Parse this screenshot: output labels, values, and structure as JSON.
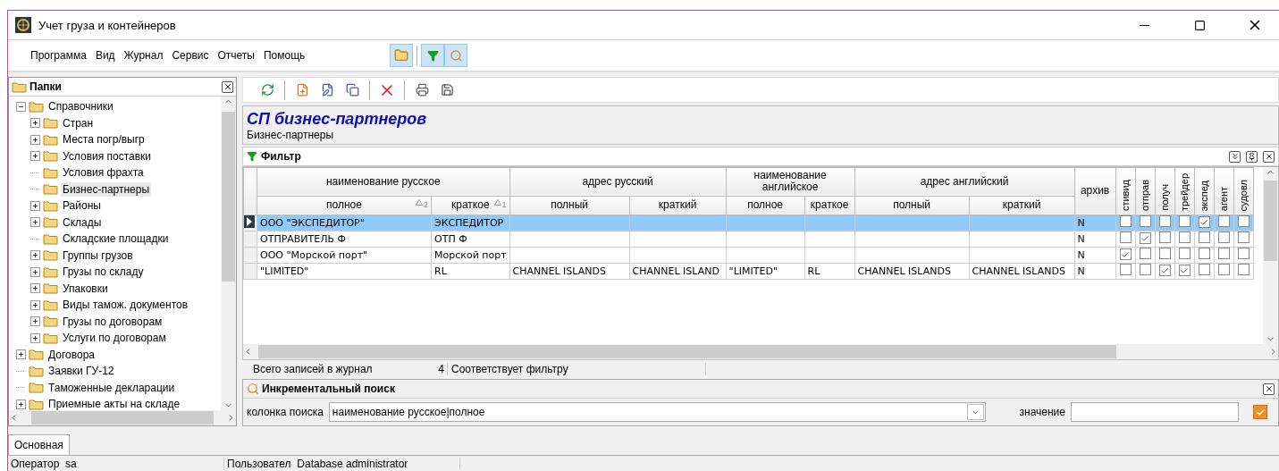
{
  "window": {
    "title": "Учет груза и контейнеров"
  },
  "menu": [
    "Программа",
    "Вид",
    "Журнал",
    "Сервис",
    "Отчеты",
    "Помощь"
  ],
  "folders": {
    "title": "Папки",
    "tree": [
      {
        "label": "Справочники",
        "expanded": true,
        "selected": false,
        "children": [
          {
            "label": "Стран",
            "expanded": false,
            "selected": false
          },
          {
            "label": "Места погр/выгр",
            "expanded": false,
            "selected": false
          },
          {
            "label": "Условия поставки",
            "expanded": false,
            "selected": false
          },
          {
            "label": "Условия фрахта",
            "selected": false
          },
          {
            "label": "Бизнес-партнеры",
            "selected": true
          },
          {
            "label": "Районы",
            "expanded": false,
            "selected": false
          },
          {
            "label": "Склады",
            "expanded": false,
            "selected": false
          },
          {
            "label": "Складские площадки",
            "selected": false
          },
          {
            "label": "Группы грузов",
            "expanded": false,
            "selected": false
          },
          {
            "label": "Грузы по складу",
            "expanded": false,
            "selected": false
          },
          {
            "label": "Упаковки",
            "expanded": false,
            "selected": false
          },
          {
            "label": "Виды тамож. документов",
            "expanded": false,
            "selected": false
          },
          {
            "label": "Грузы по договорам",
            "expanded": false,
            "selected": false
          },
          {
            "label": "Услуги по договорам",
            "expanded": false,
            "selected": false
          }
        ]
      },
      {
        "label": "Договора",
        "expanded": false,
        "selected": false
      },
      {
        "label": "Заявки ГУ-12",
        "selected": false
      },
      {
        "label": "Таможенные декларации",
        "selected": false
      },
      {
        "label": "Приемные акты на складе",
        "expanded": false,
        "selected": false
      }
    ]
  },
  "journal": {
    "title": "СП бизнес-партнеров",
    "subtitle": "Бизнес-партнеры",
    "filter_label": "Фильтр",
    "groups": [
      {
        "label": "наименование русское",
        "columns": [
          {
            "label": "полное",
            "sort": "2"
          },
          {
            "label": "краткое",
            "sort": "1"
          }
        ]
      },
      {
        "label": "адрес русский",
        "columns": [
          {
            "label": "полный"
          },
          {
            "label": "краткий"
          }
        ]
      },
      {
        "label": "наименование английское",
        "columns": [
          {
            "label": "полное"
          },
          {
            "label": "краткое"
          }
        ]
      },
      {
        "label": "адрес английский",
        "columns": [
          {
            "label": "полный"
          },
          {
            "label": "краткий"
          }
        ]
      }
    ],
    "archive_column": "архив",
    "flag_columns": [
      "стивид",
      "отправ",
      "получ",
      "трейдер",
      "экспед",
      "агент",
      "судовл"
    ],
    "rows": [
      {
        "selected": true,
        "cells": [
          "ООО \"ЭКСПЕДИТОР\"",
          "ЭКСПЕДИТОР",
          "",
          "",
          "",
          "",
          "",
          ""
        ],
        "archive": "N",
        "flags": [
          false,
          false,
          false,
          false,
          true,
          false,
          false
        ]
      },
      {
        "selected": false,
        "cells": [
          "ОТПРАВИТЕЛЬ Ф",
          "ОТП Ф",
          "",
          "",
          "",
          "",
          "",
          ""
        ],
        "archive": "N",
        "flags": [
          false,
          true,
          false,
          false,
          false,
          false,
          false
        ]
      },
      {
        "selected": false,
        "cells": [
          "ООО \"Морской порт\"",
          "Морской порт",
          "",
          "",
          "",
          "",
          "",
          ""
        ],
        "archive": "N",
        "flags": [
          true,
          false,
          false,
          false,
          false,
          false,
          false
        ]
      },
      {
        "selected": false,
        "cells": [
          "\"LIMITED\"",
          "RL",
          "CHANNEL ISLANDS",
          "CHANNEL ISLAND",
          "\"LIMITED\"",
          "RL",
          "CHANNEL ISLANDS",
          "CHANNEL ISLANDS"
        ],
        "archive": "N",
        "flags": [
          false,
          false,
          true,
          true,
          false,
          false,
          false
        ]
      }
    ],
    "summary": {
      "label": "Всего записей в журнал",
      "count": "4",
      "filter_note": "Соответствует фильтру"
    }
  },
  "search": {
    "title": "Инкрементальный поиск",
    "column_label": "колонка поиска",
    "column_value": "наименование русское|полное",
    "value_label": "значение",
    "checked": true
  },
  "tabs": [
    {
      "label": "Основная",
      "selected": true
    }
  ],
  "status_bar": [
    "Оператор  sa",
    "Пользовател  Database administrator"
  ]
}
